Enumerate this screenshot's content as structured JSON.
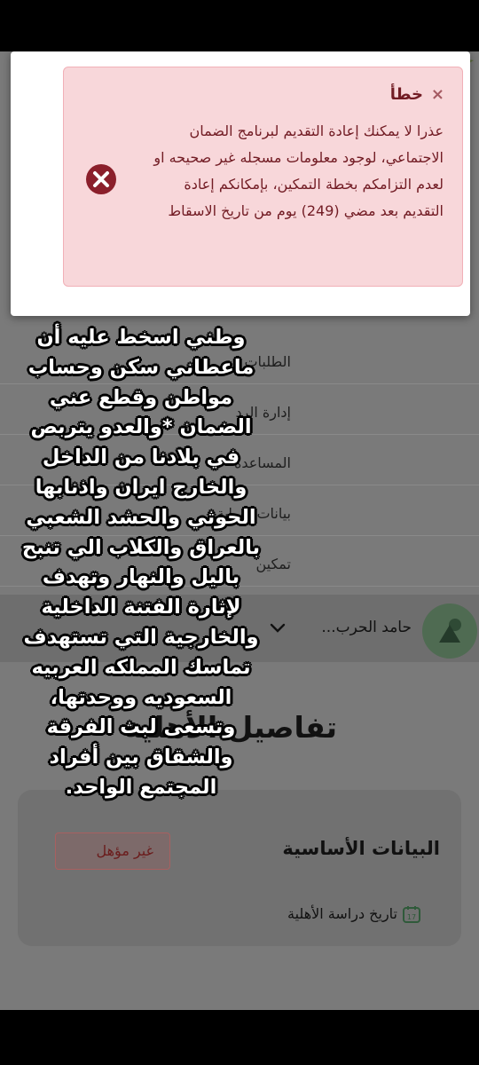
{
  "menu": {
    "items": [
      {
        "label": "الطلبات"
      },
      {
        "label": "إدارة الرد"
      },
      {
        "label": "المساعدة"
      },
      {
        "label": "بيانات البوابة"
      },
      {
        "label": "تمكين"
      }
    ]
  },
  "user": {
    "name": "حامد الحرب..."
  },
  "details": {
    "title": "تفاصيل الأهلية",
    "card_title": "البيانات الأساسية",
    "badge": "غير مؤهل",
    "date_label": "تاريخ دراسة الأهلية"
  },
  "alert": {
    "close": "×",
    "title": "خطأ",
    "body": "عذرا لا يمكنك إعادة التقديم لبرنامج الضمان الاجتماعي، لوجود معلومات مسجله غير صحيحه او لعدم التزامكم بخطة التمكين، بإمكانكم إعادة التقديم بعد مضي (249) يوم من تاريخ الاسقاط"
  },
  "overlay": {
    "caption": "وطني اسخط عليه أن ماعطاني سكن وحساب مواطن وقطع عني الضمان *والعدو يتربص في بلادنا من الداخل والخارج ايران واذنابها الحوثي والحشد الشعبي بالعراق والكلاب الي تنبح باليل والنهار وتهدف لإثارة الفتنة الداخلية والخارجية التي تستهدف تماسك المملكه العربيه السعوديه ووحدتها، وتسعى لبث الفرقة والشقاق بين أفراد المجتمع الواحد."
  },
  "colors": {
    "alert_bg": "#f8d7da",
    "alert_text": "#721c24",
    "alert_icon": "#8b1f2b"
  }
}
